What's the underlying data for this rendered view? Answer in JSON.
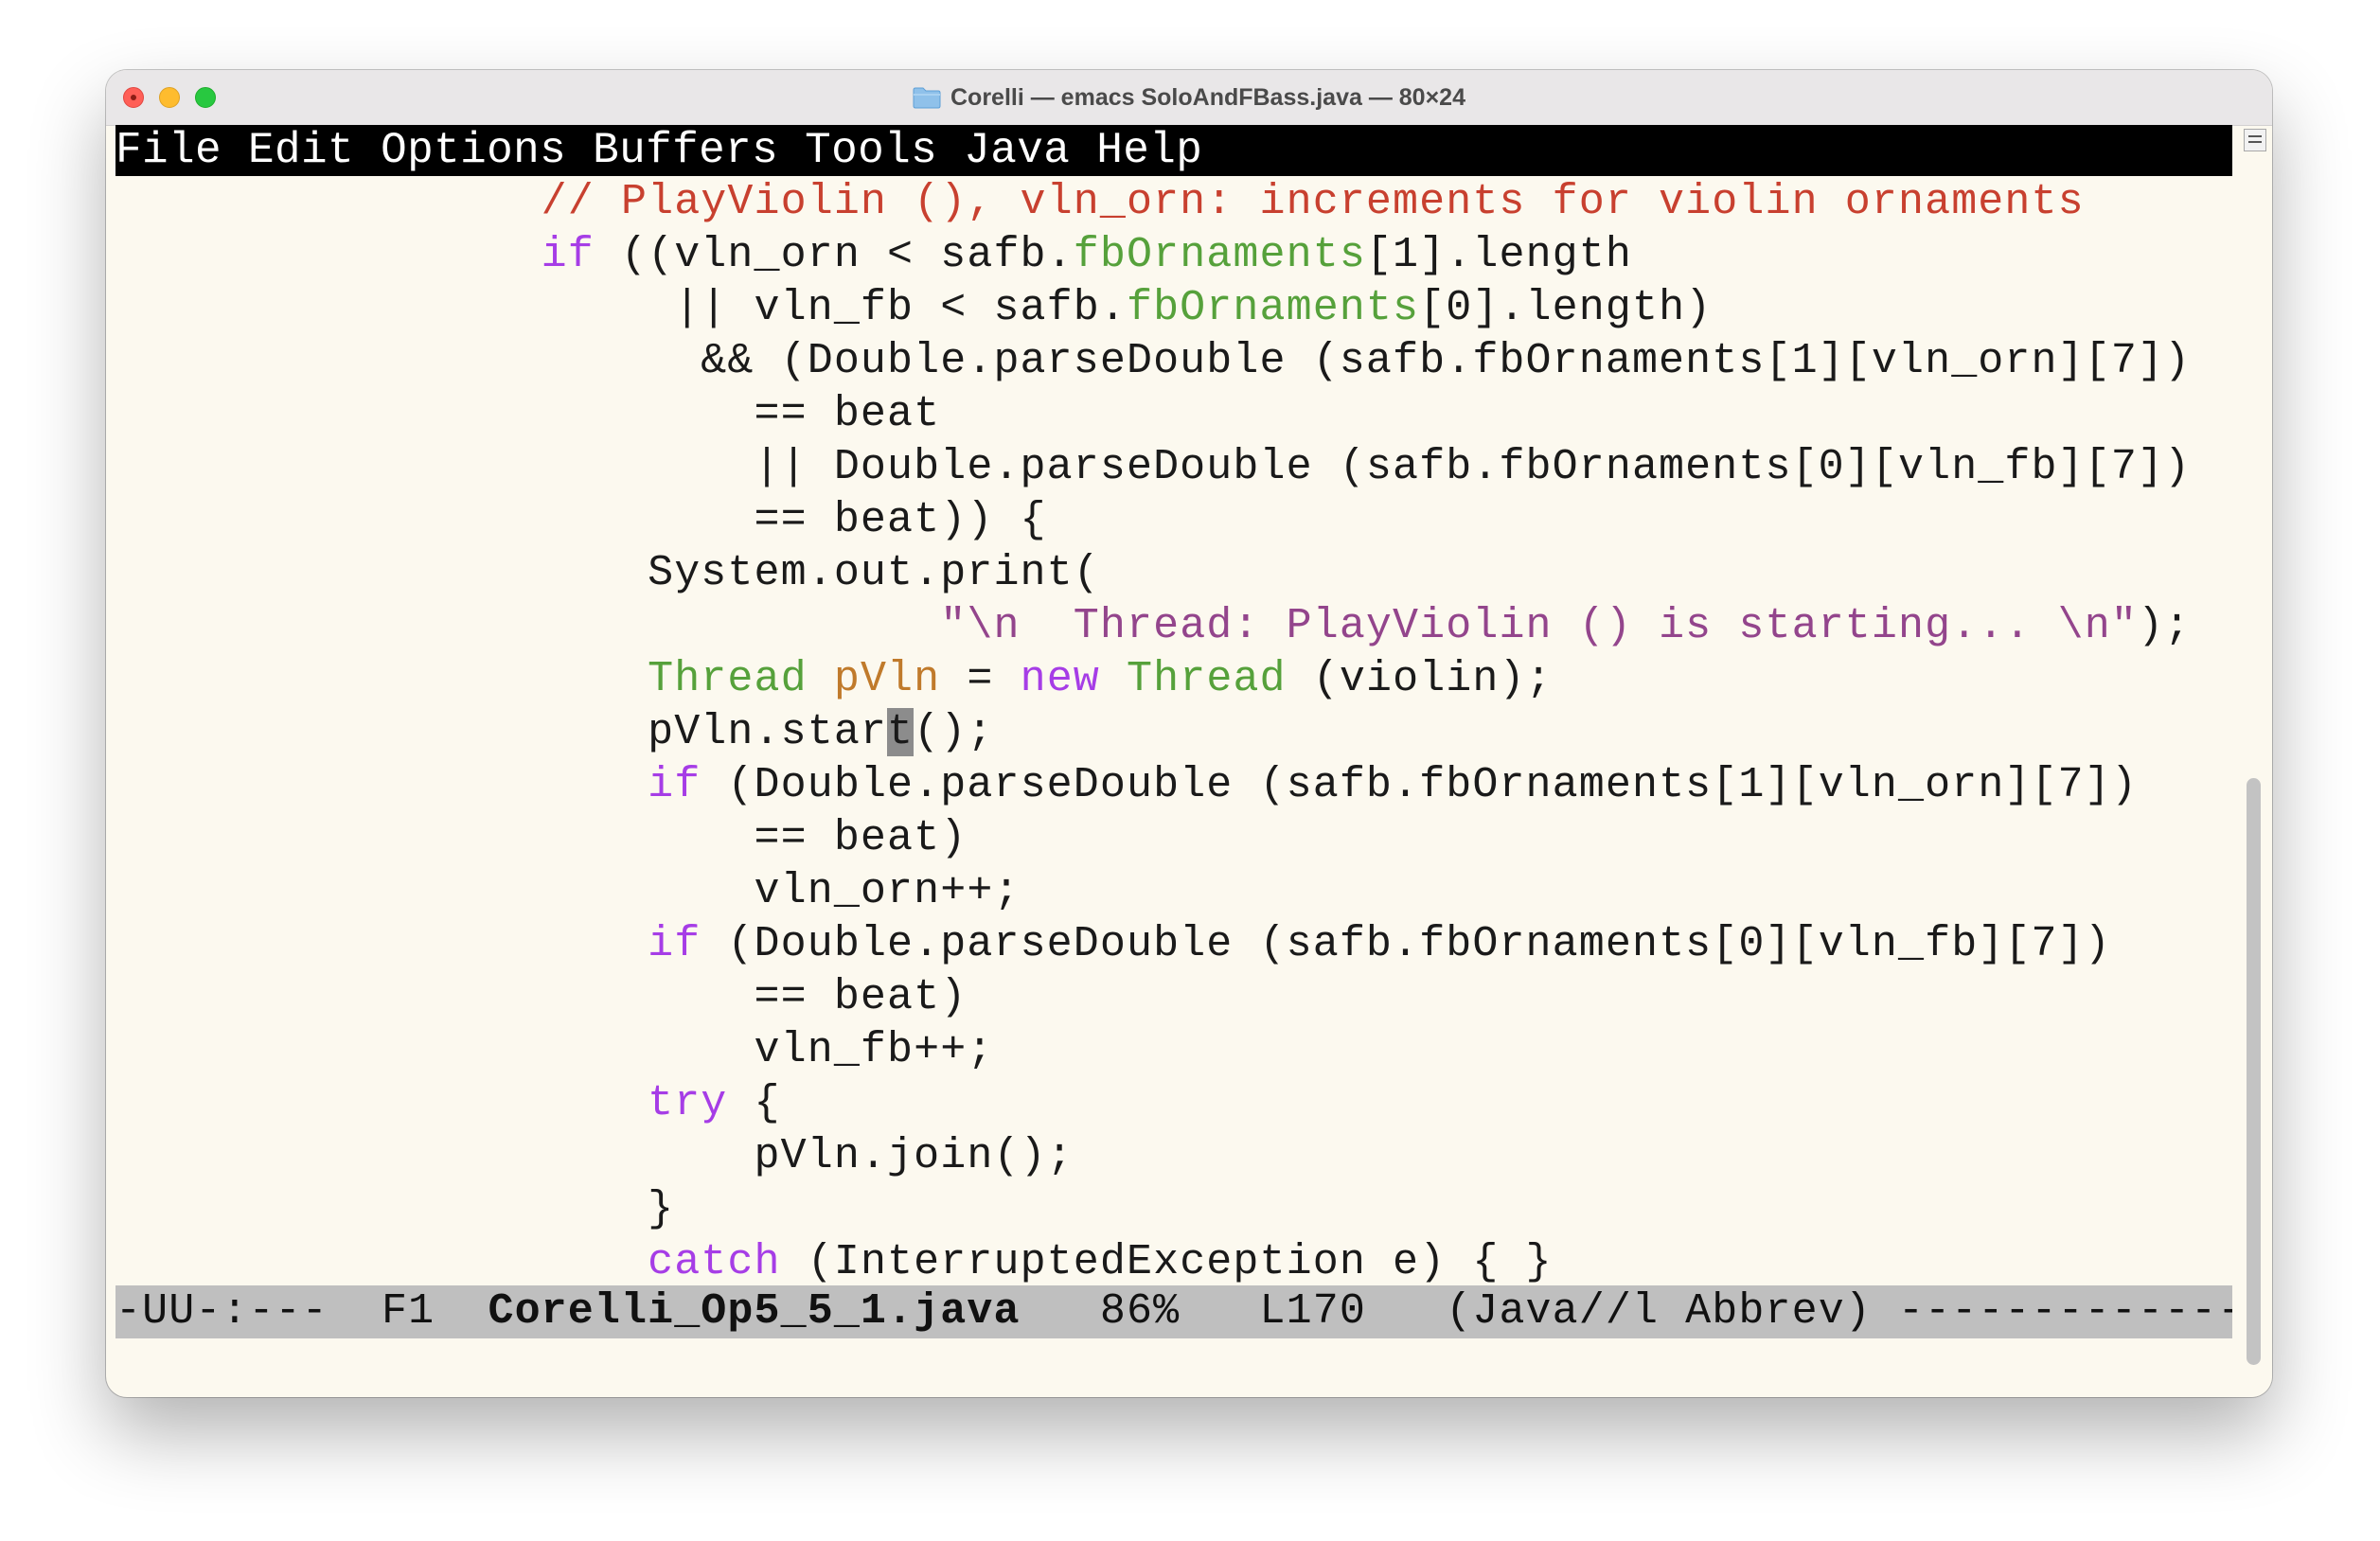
{
  "window": {
    "title": "Corelli — emacs SoloAndFBass.java — 80×24",
    "icon": "folder-icon"
  },
  "menubar": {
    "items": [
      "File",
      "Edit",
      "Options",
      "Buffers",
      "Tools",
      "Java",
      "Help"
    ]
  },
  "editor": {
    "lines": [
      [
        {
          "t": "                // PlayViolin (), vln_orn: increments for violin ornaments",
          "c": "comment"
        }
      ],
      [
        {
          "t": "                ",
          "c": "plain"
        },
        {
          "t": "if",
          "c": "keyword"
        },
        {
          "t": " ((vln_orn < safb.",
          "c": "plain"
        },
        {
          "t": "fbOrnaments",
          "c": "type"
        },
        {
          "t": "[1].length",
          "c": "plain"
        }
      ],
      [
        {
          "t": "                     || vln_fb < safb.",
          "c": "plain"
        },
        {
          "t": "fbOrnaments",
          "c": "type"
        },
        {
          "t": "[0].length)",
          "c": "plain"
        }
      ],
      [
        {
          "t": "                      && (Double.parseDouble (safb.fbOrnaments[1][vln_orn][7])",
          "c": "plain"
        }
      ],
      [
        {
          "t": "                        == beat",
          "c": "plain"
        }
      ],
      [
        {
          "t": "                        || Double.parseDouble (safb.fbOrnaments[0][vln_fb][7])",
          "c": "plain"
        }
      ],
      [
        {
          "t": "                        == beat)) {",
          "c": "plain"
        }
      ],
      [
        {
          "t": "                    System.out.print(",
          "c": "plain"
        }
      ],
      [
        {
          "t": "                               ",
          "c": "plain"
        },
        {
          "t": "\"\\n  Thread: PlayViolin () is starting... \\n\"",
          "c": "string"
        },
        {
          "t": ");",
          "c": "plain"
        }
      ],
      [
        {
          "t": "                    ",
          "c": "plain"
        },
        {
          "t": "Thread",
          "c": "type"
        },
        {
          "t": " ",
          "c": "plain"
        },
        {
          "t": "pVln",
          "c": "var"
        },
        {
          "t": " = ",
          "c": "plain"
        },
        {
          "t": "new",
          "c": "keyword"
        },
        {
          "t": " ",
          "c": "plain"
        },
        {
          "t": "Thread",
          "c": "type"
        },
        {
          "t": " (violin);",
          "c": "plain"
        }
      ],
      [
        {
          "t": "                    pVln.star",
          "c": "plain"
        },
        {
          "t": "t",
          "c": "cursor"
        },
        {
          "t": "();",
          "c": "plain"
        }
      ],
      [
        {
          "t": "                    ",
          "c": "plain"
        },
        {
          "t": "if",
          "c": "keyword"
        },
        {
          "t": " (Double.parseDouble (safb.fbOrnaments[1][vln_orn][7])",
          "c": "plain"
        }
      ],
      [
        {
          "t": "                        == beat)",
          "c": "plain"
        }
      ],
      [
        {
          "t": "                        vln_orn++;",
          "c": "plain"
        }
      ],
      [
        {
          "t": "                    ",
          "c": "plain"
        },
        {
          "t": "if",
          "c": "keyword"
        },
        {
          "t": " (Double.parseDouble (safb.fbOrnaments[0][vln_fb][7])",
          "c": "plain"
        }
      ],
      [
        {
          "t": "                        == beat)",
          "c": "plain"
        }
      ],
      [
        {
          "t": "                        vln_fb++;",
          "c": "plain"
        }
      ],
      [
        {
          "t": "                    ",
          "c": "plain"
        },
        {
          "t": "try",
          "c": "keyword"
        },
        {
          "t": " {",
          "c": "plain"
        }
      ],
      [
        {
          "t": "                        pVln.join();",
          "c": "plain"
        }
      ],
      [
        {
          "t": "                    }",
          "c": "plain"
        }
      ],
      [
        {
          "t": "                    ",
          "c": "plain"
        },
        {
          "t": "catch",
          "c": "keyword"
        },
        {
          "t": " (InterruptedException e) { }",
          "c": "plain"
        }
      ]
    ]
  },
  "modeline": {
    "prefix": "-UU-:---  F1  ",
    "buffer_name": "Corelli_Op5_5_1.java",
    "suffix": "   86%   L170   (Java//l Abbrev) ------------------------------------"
  },
  "colors": {
    "comment": "#c8402f",
    "keyword": "#a63de6",
    "type": "#56a13b",
    "variable": "#c07a2b",
    "string": "#93458c",
    "background": "#fcf9ef",
    "menubar": "#000000",
    "modeline": "#bfbfbf"
  }
}
